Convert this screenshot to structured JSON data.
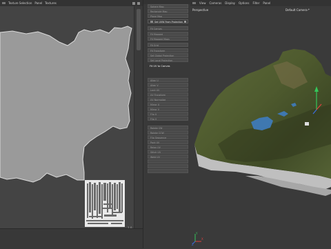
{
  "left_panel": {
    "menu": [
      "Texture Selection",
      "Panel",
      "Textures"
    ]
  },
  "uv_footer": {
    "corner_value": "1.0"
  },
  "mid_panel": {
    "buttons": [
      {
        "label": "Sphere Map"
      },
      {
        "label": "Rectangle Map"
      },
      {
        "label": "Plane Map"
      },
      {
        "label": "Set UVW From Projection"
      },
      {
        "label": "Fit Canvas"
      },
      {
        "label": "Fit Mapped"
      },
      {
        "label": "Fit Mapped Maps"
      },
      {
        "label": "Fit Grid"
      },
      {
        "label": "Fit Transform"
      },
      {
        "label": "Set Global Projection"
      },
      {
        "label": "Set Local Projection"
      },
      {
        "label": "Align U"
      },
      {
        "label": "Align V"
      },
      {
        "label": "Lock UV"
      },
      {
        "label": "UV Transform"
      },
      {
        "label": "UV Normalize"
      },
      {
        "label": "Mirror U"
      },
      {
        "label": "Mirror V"
      },
      {
        "label": "Flip U"
      },
      {
        "label": "Flip V"
      },
      {
        "label": "Rotate CW"
      },
      {
        "label": "Rotate CCW"
      },
      {
        "label": "Flip Sequence"
      },
      {
        "label": "Pack UV"
      },
      {
        "label": "Relax UV"
      },
      {
        "label": "Stitch UV"
      },
      {
        "label": "Weld UV"
      }
    ],
    "active_label": "Set UVW From Projection",
    "fit_canvas_label": "Fit UV to Canvas"
  },
  "right_panel": {
    "menu": [
      "View",
      "Cameras",
      "Display",
      "Options",
      "Filter",
      "Panel"
    ],
    "view_label": "Perspective",
    "camera_label": "Default Camera",
    "camera_mark": "·*"
  },
  "axis": {
    "x_label": "X",
    "y_label": "Y",
    "z_label": "Z"
  }
}
